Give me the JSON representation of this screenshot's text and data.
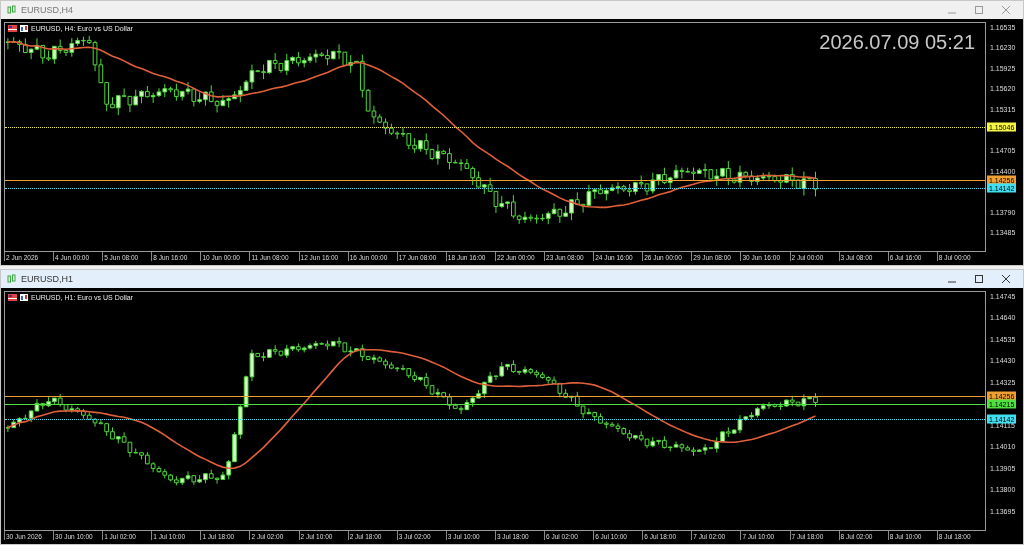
{
  "windows": [
    {
      "title": "EURUSD,H4",
      "active": false,
      "header": "EURUSD, H4:  Euro vs US Dollar",
      "date_overlay": "2026.07.09 05:21",
      "y_ticks": [
        "1.16535",
        "1.16230",
        "1.15925",
        "1.15620",
        "1.15315",
        "1.14705",
        "1.14400",
        "1.13790",
        "1.13485"
      ],
      "price_lines": [
        {
          "label": "1.15046",
          "color": "#f5f542",
          "kind": "dashed"
        },
        {
          "label": "1.14256",
          "color": "#f0a030",
          "kind": "solid"
        },
        {
          "label": "1.14142",
          "color": "#40e0f0",
          "kind": "dashed"
        }
      ],
      "x_ticks": [
        "2 Jun 2026",
        "4 Jun 00:00",
        "5 Jun 08:00",
        "8 Jun 16:00",
        "10 Jun 00:00",
        "11 Jun 08:00",
        "12 Jun 16:00",
        "16 Jun 00:00",
        "17 Jun 08:00",
        "18 Jun 16:00",
        "22 Jun 00:00",
        "23 Jun 08:00",
        "24 Jun 16:00",
        "26 Jun 00:00",
        "29 Jun 08:00",
        "30 Jun 16:00",
        "2 Jul 00:00",
        "3 Jul 08:00",
        "6 Jul 16:00",
        "8 Jul 00:00"
      ]
    },
    {
      "title": "EURUSD,H1",
      "active": true,
      "header": "EURUSD, H1:  Euro vs US Dollar",
      "y_ticks": [
        "1.14745",
        "1.14640",
        "1.14535",
        "1.14430",
        "1.14325",
        "1.14115",
        "1.14010",
        "1.13905",
        "1.13800",
        "1.13695"
      ],
      "price_lines": [
        {
          "label": "1.14256",
          "color": "#f0a030",
          "kind": "solid"
        },
        {
          "label": "1.14215",
          "color": "#50e040",
          "kind": "solid"
        },
        {
          "label": "1.14142",
          "color": "#40e0f0",
          "kind": "dashed"
        }
      ],
      "x_ticks": [
        "30 Jun 2026",
        "30 Jun 10:00",
        "1 Jul 02:00",
        "1 Jul 10:00",
        "1 Jul 18:00",
        "2 Jul 02:00",
        "2 Jul 10:00",
        "2 Jul 18:00",
        "3 Jul 02:00",
        "3 Jul 10:00",
        "3 Jul 18:00",
        "6 Jul 02:00",
        "6 Jul 10:00",
        "6 Jul 18:00",
        "7 Jul 02:00",
        "7 Jul 10:00",
        "7 Jul 18:00",
        "8 Jul 02:00",
        "8 Jul 10:00",
        "8 Jul 18:00"
      ]
    }
  ]
}
